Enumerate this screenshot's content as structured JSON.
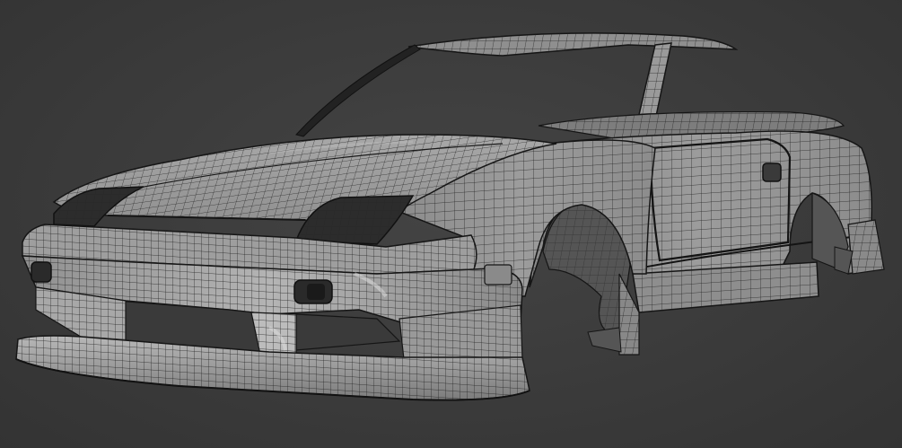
{
  "scene": {
    "subject_icon": "car-wireframe-icon",
    "background_color": "#3a3a3a",
    "body_color": "#9a9a9a",
    "wire_color": "#1f1f1f",
    "highlight_color": "#d8d8d8"
  }
}
